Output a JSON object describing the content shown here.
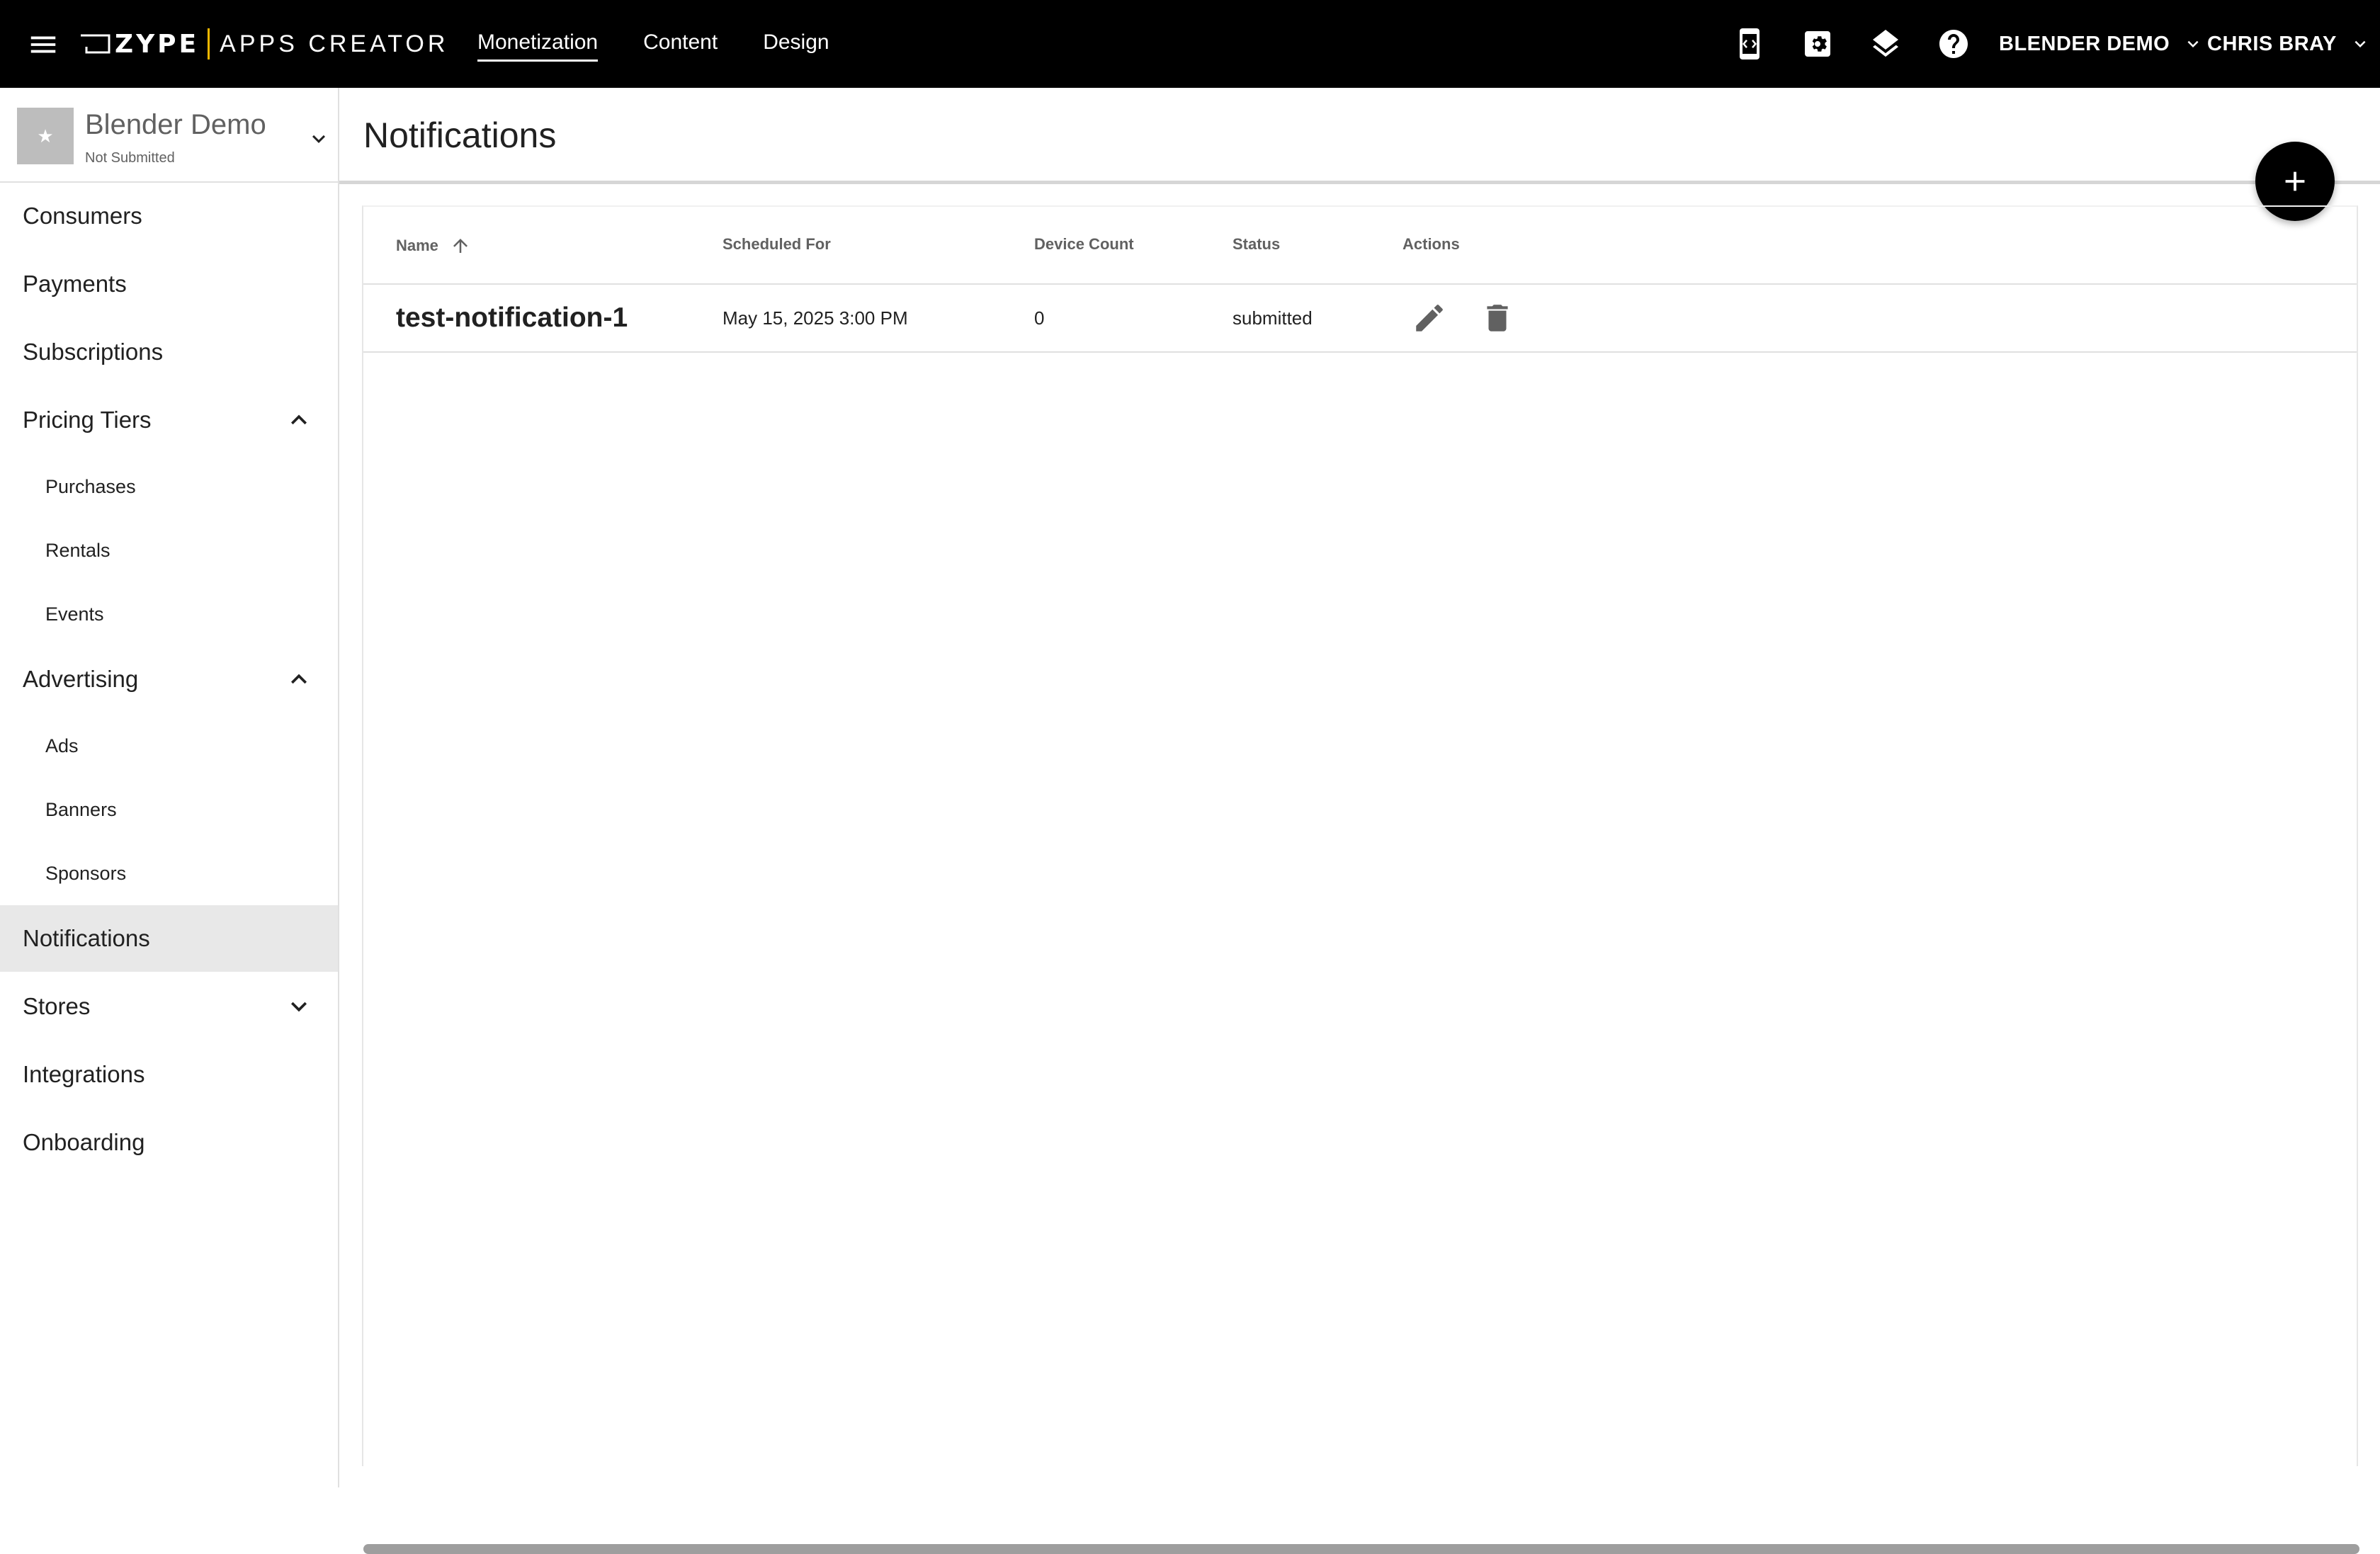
{
  "topbar": {
    "brand_zype": "ZYPE",
    "brand_product": "APPS CREATOR",
    "nav": [
      {
        "label": "Monetization",
        "active": true
      },
      {
        "label": "Content",
        "active": false
      },
      {
        "label": "Design",
        "active": false
      }
    ],
    "icons": [
      "mobile-preview-icon",
      "settings-icon",
      "layers-icon",
      "help-icon"
    ],
    "account_label": "BLENDER DEMO",
    "user_label": "CHRIS BRAY"
  },
  "sidebar": {
    "app_name": "Blender Demo",
    "app_status": "Not Submitted",
    "items": [
      {
        "label": "Consumers"
      },
      {
        "label": "Payments"
      },
      {
        "label": "Subscriptions"
      },
      {
        "label": "Pricing Tiers",
        "expanded": true
      },
      {
        "label": "Purchases",
        "sub": true
      },
      {
        "label": "Rentals",
        "sub": true
      },
      {
        "label": "Events",
        "sub": true
      },
      {
        "label": "Advertising",
        "expanded": true
      },
      {
        "label": "Ads",
        "sub": true
      },
      {
        "label": "Banners",
        "sub": true
      },
      {
        "label": "Sponsors",
        "sub": true
      },
      {
        "label": "Notifications",
        "active": true
      },
      {
        "label": "Stores",
        "expanded": false
      },
      {
        "label": "Integrations"
      },
      {
        "label": "Onboarding"
      }
    ]
  },
  "main": {
    "title": "Notifications",
    "table": {
      "columns": [
        "Name",
        "Scheduled For",
        "Device Count",
        "Status",
        "Actions"
      ],
      "sort": {
        "column": "Name",
        "direction": "ascending"
      },
      "rows": [
        {
          "name": "test-notification-1",
          "scheduled_for": "May 15, 2025 3:00 PM",
          "device_count": "0",
          "status": "submitted"
        }
      ]
    }
  },
  "colors": {
    "topbar_bg": "#000000",
    "logo_accent": "#f5b800",
    "active_nav_bg": "#e8e8e8",
    "fab_bg": "#000000"
  }
}
